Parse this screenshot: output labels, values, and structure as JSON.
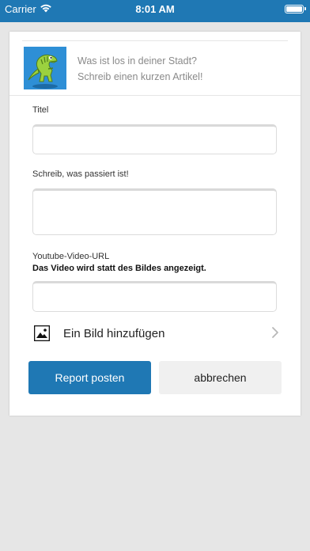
{
  "status_bar": {
    "carrier": "Carrier",
    "time": "8:01 AM",
    "icons": [
      "wifi-icon",
      "battery-icon"
    ]
  },
  "header": {
    "image": "dinosaur-avatar",
    "line1": "Was ist los in deiner Stadt?",
    "line2": "Schreib einen kurzen Artikel!"
  },
  "form": {
    "title_label": "Titel",
    "title_value": "",
    "body_label": "Schreib, was passiert ist!",
    "body_value": "",
    "youtube_label": "Youtube-Video-URL",
    "youtube_hint": "Das Video wird statt des Bildes angezeigt.",
    "youtube_value": ""
  },
  "add_image": {
    "label": "Ein Bild hinzufügen",
    "icon": "image-icon",
    "chevron": "chevron-right-icon"
  },
  "buttons": {
    "submit": "Report posten",
    "cancel": "abbrechen"
  },
  "colors": {
    "accent": "#1f78b4",
    "background": "#e6e6e6",
    "secondary_button": "#f0f0f0"
  }
}
